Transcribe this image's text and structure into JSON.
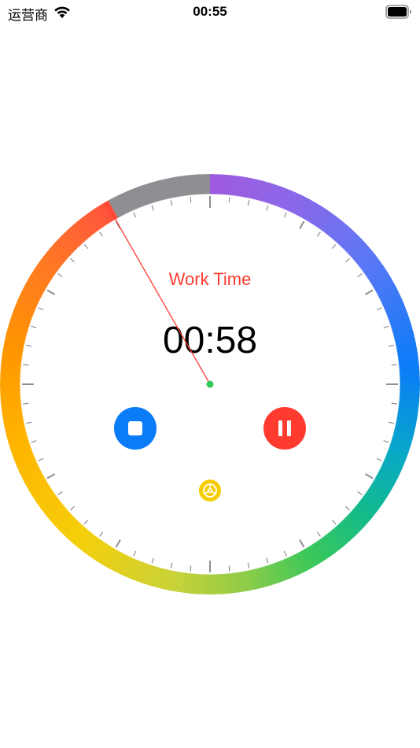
{
  "status_bar": {
    "carrier": "运营商",
    "time": "00:55"
  },
  "timer": {
    "mode_label": "Work Time",
    "remaining": "00:58",
    "elapsed_fraction": 0.917
  },
  "controls": {
    "stop": "stop-icon",
    "pause": "pause-icon",
    "settings": "gear-icon"
  },
  "colors": {
    "work_label": "#ff3b30",
    "stop_button": "#0a7cf8",
    "pause_button": "#ff3b30",
    "settings_button": "#f5cc00",
    "hand": "#ff3b30",
    "hand_center": "#34c759",
    "remaining_track": "#8e8e93"
  }
}
